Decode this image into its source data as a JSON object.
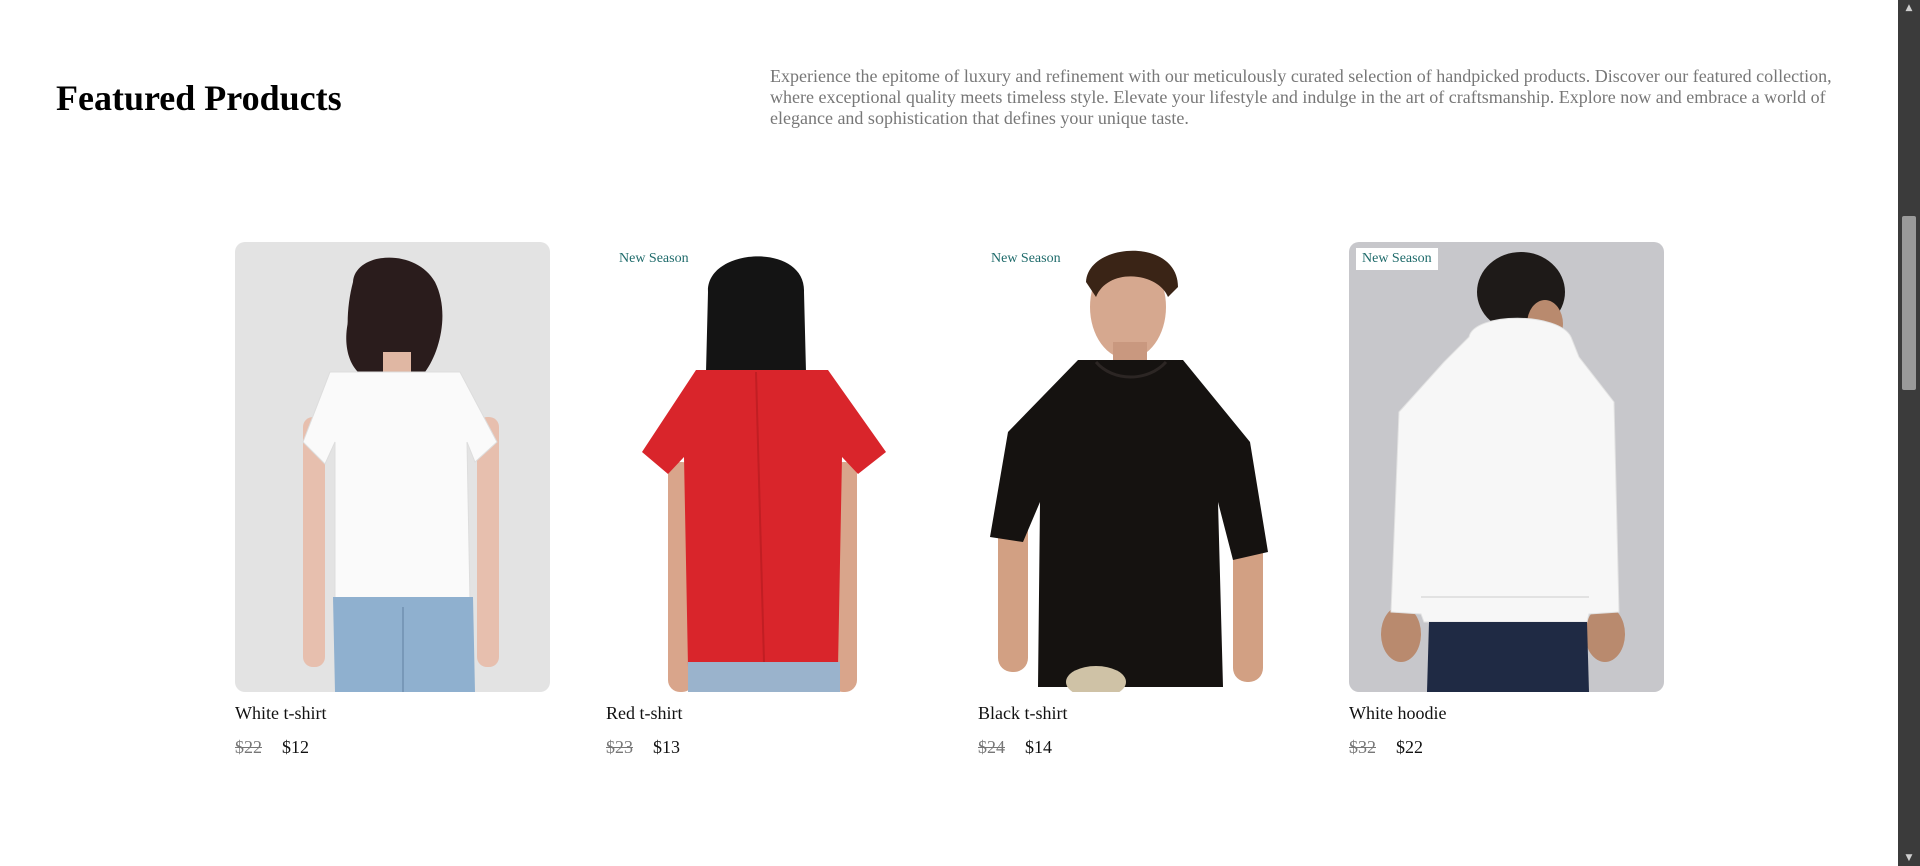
{
  "header": {
    "title": "Featured Products",
    "intro": "Experience the epitome of luxury and refinement with our meticulously curated selection of handpicked products. Discover our featured collection, where exceptional quality meets timeless style. Elevate your lifestyle and indulge in the art of craftsmanship. Explore now and embrace a world of elegance and sophistication that defines your unique taste."
  },
  "products": [
    {
      "name": "White t-shirt",
      "old_price": "$22",
      "price": "$12",
      "badge": ""
    },
    {
      "name": "Red t-shirt",
      "old_price": "$23",
      "price": "$13",
      "badge": "New Season"
    },
    {
      "name": "Black t-shirt",
      "old_price": "$24",
      "price": "$14",
      "badge": "New Season"
    },
    {
      "name": "White hoodie",
      "old_price": "$32",
      "price": "$22",
      "badge": "New Season"
    }
  ],
  "colors": {
    "badge_text": "#1f6b6b",
    "muted_text": "#777777",
    "scrollbar": "#3b3b3b",
    "red_shirt": "#d9252b"
  },
  "icons": {
    "scroll_up": "triangle-up-icon",
    "scroll_down": "triangle-down-icon"
  }
}
